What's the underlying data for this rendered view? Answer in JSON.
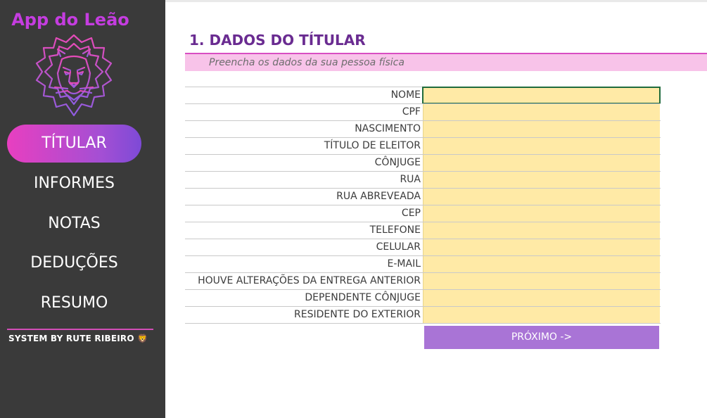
{
  "app": {
    "title": "App do Leão"
  },
  "sidebar": {
    "items": [
      {
        "label": "TÍTULAR",
        "active": true
      },
      {
        "label": "INFORMES",
        "active": false
      },
      {
        "label": "NOTAS",
        "active": false
      },
      {
        "label": "DEDUÇÕES",
        "active": false
      },
      {
        "label": "RESUMO",
        "active": false
      }
    ],
    "credit": "SYSTEM BY RUTE RIBEIRO",
    "credit_emoji": "🦁"
  },
  "main": {
    "title": "1. DADOS DO TÍTULAR",
    "subtitle": "Preencha os dados da sua pessoa física",
    "fields": [
      {
        "label": "NOME",
        "value": ""
      },
      {
        "label": "CPF",
        "value": ""
      },
      {
        "label": "NASCIMENTO",
        "value": ""
      },
      {
        "label": "TÍTULO DE ELEITOR",
        "value": ""
      },
      {
        "label": "CÔNJUGE",
        "value": ""
      },
      {
        "label": "RUA",
        "value": ""
      },
      {
        "label": "RUA ABREVEADA",
        "value": ""
      },
      {
        "label": "CEP",
        "value": ""
      },
      {
        "label": "TELEFONE",
        "value": ""
      },
      {
        "label": "CELULAR",
        "value": ""
      },
      {
        "label": "E-MAIL",
        "value": ""
      },
      {
        "label": "HOUVE ALTERAÇÕES DA ENTREGA ANTERIOR",
        "value": ""
      },
      {
        "label": "DEPENDENTE CÔNJUGE",
        "value": ""
      },
      {
        "label": "RESIDENTE DO EXTERIOR",
        "value": ""
      }
    ],
    "next_button": "PRÓXIMO ->"
  },
  "colors": {
    "sidebar_bg": "#3a3a3a",
    "accent_pink": "#e83fc0",
    "accent_purple": "#a974d6",
    "title_purple": "#6a2c91",
    "field_yellow": "#ffeaa6",
    "subtitle_bg": "#f8c3e9"
  },
  "icons": {
    "logo": "lion-head-icon"
  }
}
